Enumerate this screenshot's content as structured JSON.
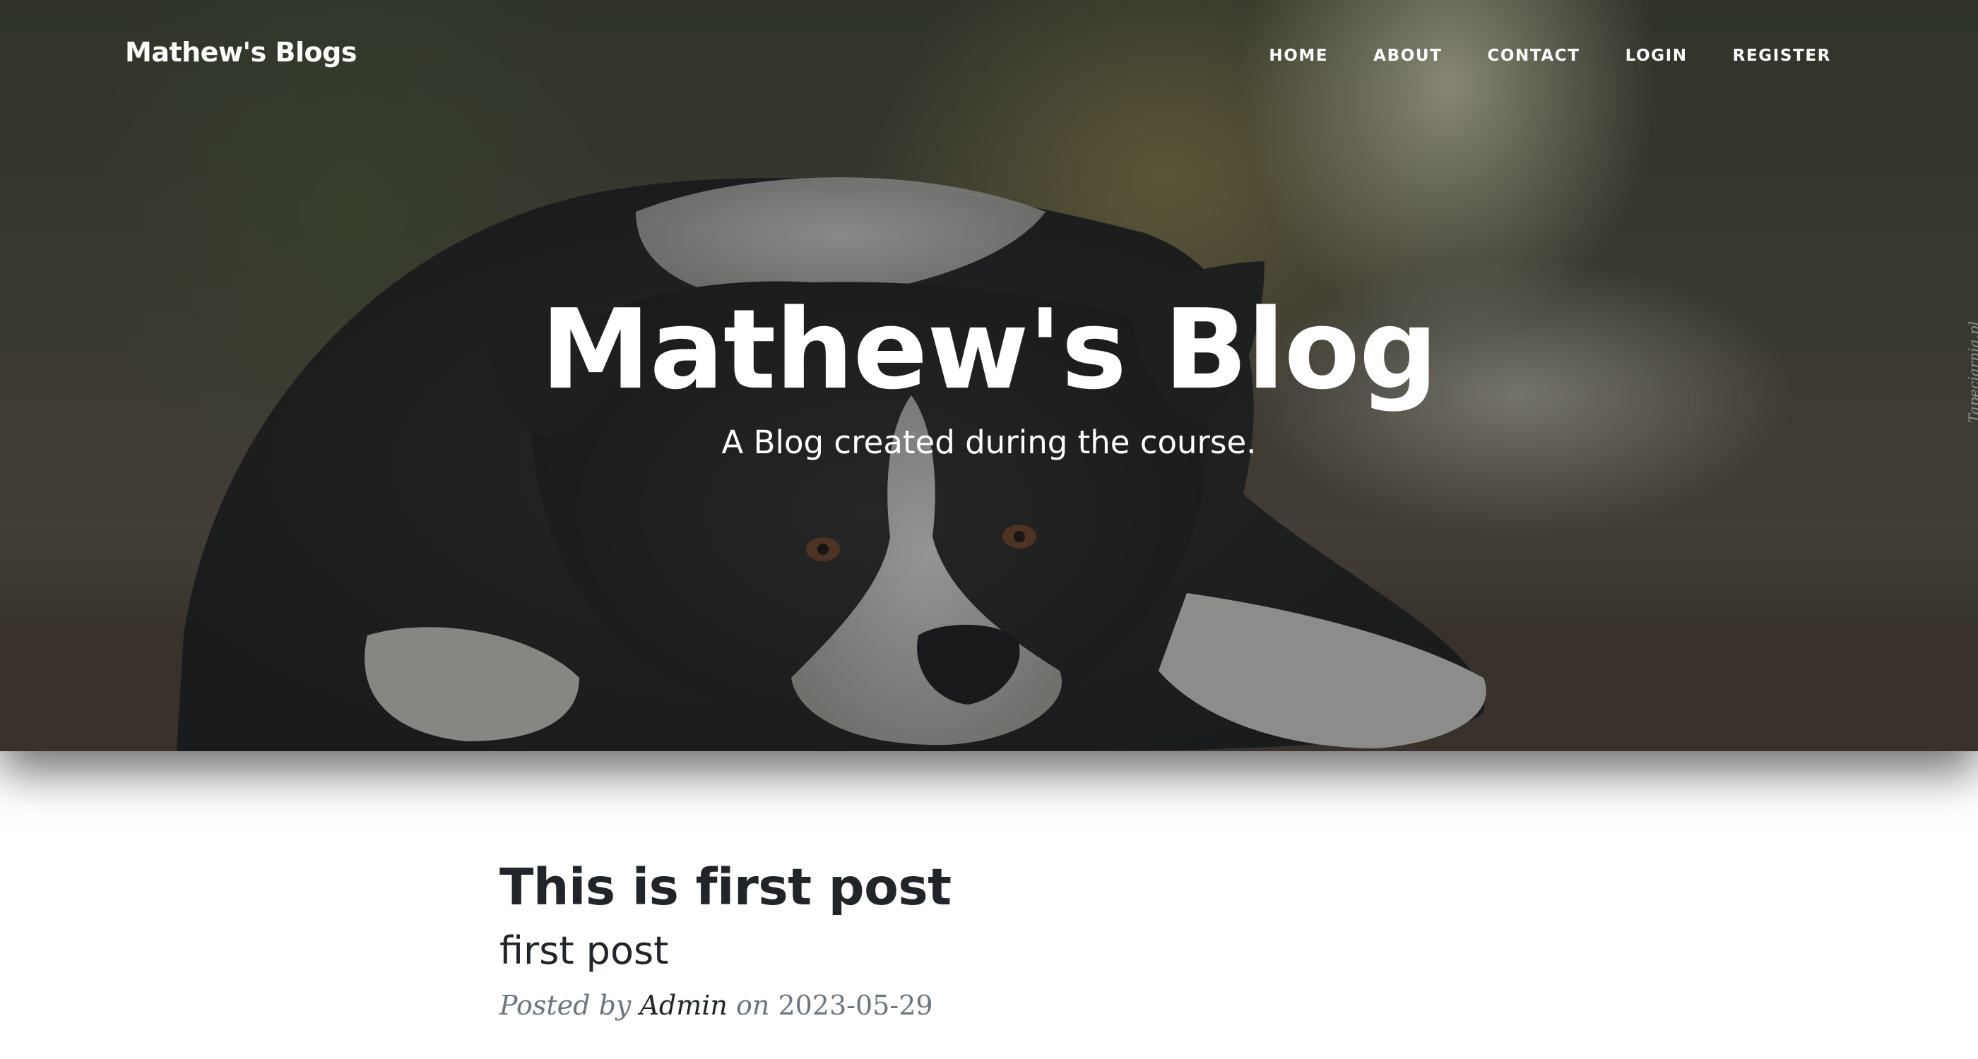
{
  "navbar": {
    "brand": "Mathew's Blogs",
    "links": [
      "HOME",
      "ABOUT",
      "CONTACT",
      "LOGIN",
      "REGISTER"
    ]
  },
  "hero": {
    "title": "Mathew's Blog",
    "subtitle": "A Blog created during the course.",
    "watermark": "Tapeciarnia.pl"
  },
  "post": {
    "title": "This is first post",
    "subtitle": "first post",
    "meta_prefix": "Posted by",
    "author": "Admin",
    "meta_on": "on",
    "date": "2023-05-29"
  },
  "colors": {
    "text_dark": "#212529",
    "meta_gray": "#6c757d",
    "hero_text": "#ffffff"
  }
}
